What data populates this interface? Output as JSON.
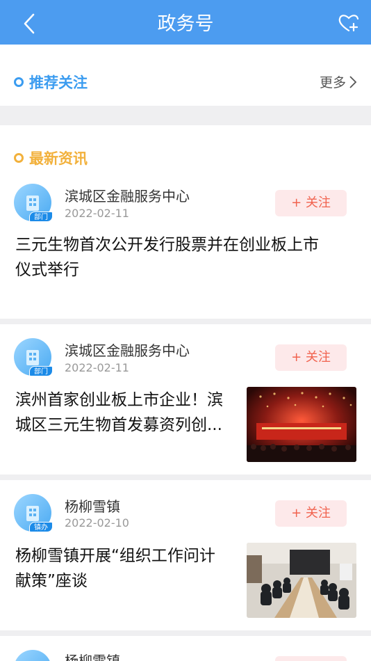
{
  "header": {
    "title": "政务号",
    "back_icon": "chevron-left-icon",
    "favorite_icon": "heart-plus-icon"
  },
  "recommend": {
    "title": "推荐关注",
    "more_label": "更多",
    "accent": "#3b9cf0"
  },
  "latest": {
    "title": "最新资讯",
    "accent": "#f2b13c"
  },
  "articles": [
    {
      "source": "滨城区金融服务中心",
      "date": "2022-02-11",
      "badge": "部门",
      "follow_label": "+ 关注",
      "headline_line1": "三元生物首次公开发行股票并在创业板上市",
      "headline_line2": "仪式举行"
    },
    {
      "source": "滨城区金融服务中心",
      "date": "2022-02-11",
      "badge": "部门",
      "follow_label": "+ 关注",
      "headline_line1": "滨州首家创业板上市企业！滨",
      "headline_line2": "城区三元生物首发募资列创..."
    },
    {
      "source": "杨柳雪镇",
      "date": "2022-02-10",
      "badge": "镇办",
      "follow_label": "+ 关注",
      "headline_line1": "杨柳雪镇开展“组织工作问计",
      "headline_line2": "献策”座谈"
    },
    {
      "source": "杨柳雪镇"
    }
  ],
  "colors": {
    "header_bg": "#4c9cf0",
    "follow_text": "#f1624e",
    "follow_bg": "#fde9ea"
  }
}
